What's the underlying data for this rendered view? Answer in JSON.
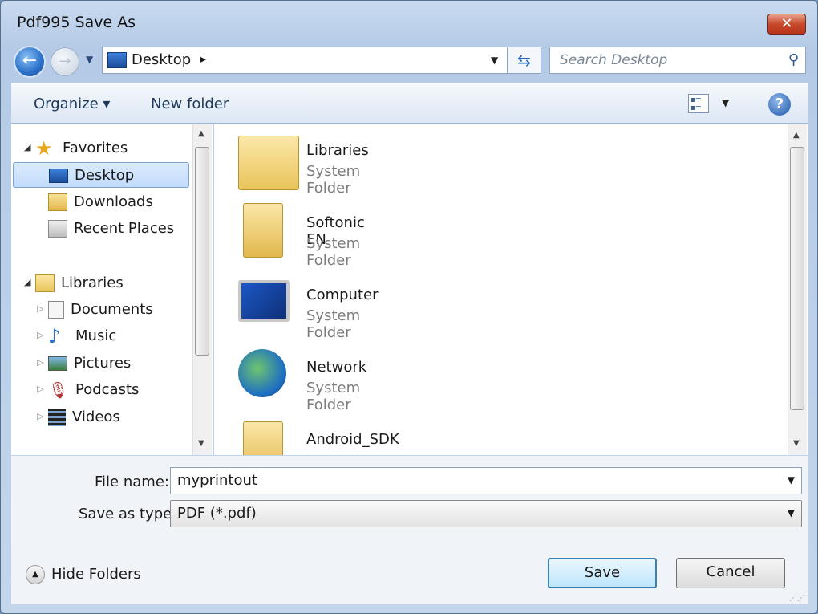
{
  "window": {
    "title": "Pdf995 Save As",
    "close_glyph": "✕"
  },
  "address": {
    "location": "Desktop",
    "separator": "▸"
  },
  "search": {
    "placeholder": "Search Desktop"
  },
  "toolbar": {
    "organize": "Organize ▾",
    "new_folder": "New folder",
    "help": "?"
  },
  "nav": {
    "favorites": "Favorites",
    "favorites_items": [
      "Desktop",
      "Downloads",
      "Recent Places"
    ],
    "libraries": "Libraries",
    "library_items": [
      "Documents",
      "Music",
      "Pictures",
      "Podcasts",
      "Videos"
    ]
  },
  "content": {
    "items": [
      {
        "name": "Libraries",
        "type": "System Folder"
      },
      {
        "name": "Softonic EN",
        "type": "System Folder"
      },
      {
        "name": "Computer",
        "type": "System Folder"
      },
      {
        "name": "Network",
        "type": "System Folder"
      },
      {
        "name": "Android_SDK",
        "type": ""
      }
    ]
  },
  "form": {
    "file_name_label": "File name:",
    "file_name_value": "myprintout",
    "save_type_label": "Save as type:",
    "save_type_value": "PDF (*.pdf)"
  },
  "footer": {
    "hide_folders": "Hide Folders",
    "save": "Save",
    "cancel": "Cancel"
  },
  "colors": {
    "accent": "#3c7fb1",
    "selection": "#c1dbfc",
    "close": "#c84a2c"
  }
}
